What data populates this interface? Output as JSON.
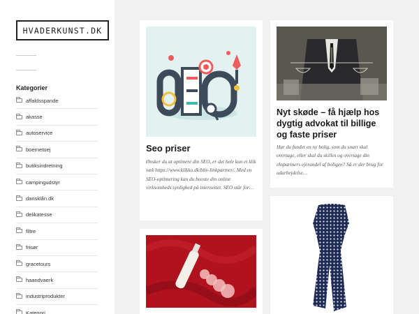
{
  "site": {
    "logo": "HVADERKUNST.DK"
  },
  "sidebar": {
    "categories_title": "Kategorier",
    "categories": [
      "affaldsspande",
      "akasse",
      "autoservice",
      "boernetoej",
      "butiksindretning",
      "campingudstyr",
      "dansklån.dk",
      "delikatesse",
      "filtre",
      "frisør",
      "gracetours",
      "haandvaerk",
      "industriprodukter",
      "Kategori"
    ]
  },
  "posts": [
    {
      "title": "Seo priser",
      "excerpt": "Ønsker du at optimere din SEO, er det hele kun et klik væk https://www.klikko.dk/bliv-linkpartner/. Med en SEO-optimering kan du booste din online virksomheds synlighed på internettet. SEO står for…",
      "image_label": "SEO"
    },
    {
      "title": "Nyt skøde – få hjælp hos dygtig advokat til billige og faste priser",
      "excerpt": "Har du fundet en ny bolig, som du snart skal overtage, eller skal du skilles og overtage din ekspartners ejerandel af boligen? Så er der brug for udarbejdelse…"
    },
    {
      "title": ""
    },
    {
      "title": ""
    }
  ]
}
